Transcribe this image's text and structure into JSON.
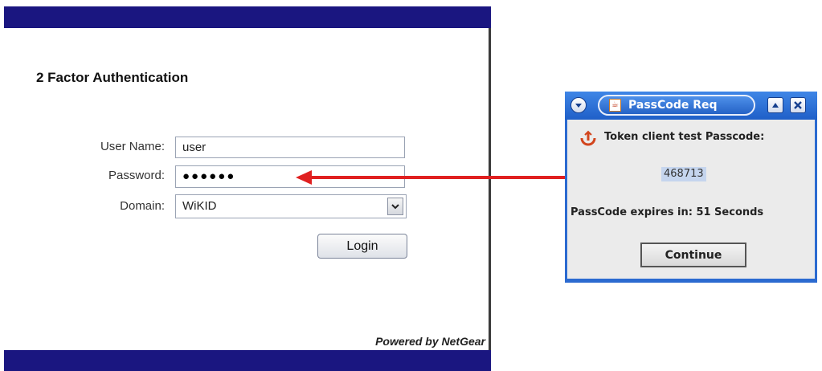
{
  "login": {
    "title": "2 Factor Authentication",
    "username_label": "User Name:",
    "username_value": "user",
    "password_label": "Password:",
    "password_masked": "●●●●●●",
    "domain_label": "Domain:",
    "domain_value": "WiKID",
    "login_button": "Login",
    "powered_by": "Powered by NetGear",
    "bar_color": "#1a1680"
  },
  "passcode_window": {
    "title": "PassCode Req",
    "token_label": "Token client test Passcode:",
    "passcode": "468713",
    "expires": "PassCode expires in: 51 Seconds",
    "continue_button": "Continue",
    "frame_color": "#2b6ad0"
  },
  "arrow": {
    "color": "#e02020",
    "points_to": "password-field"
  },
  "icons": {
    "window_menu": "window-menu-icon",
    "java_app": "java-app-icon",
    "maximize": "maximize-icon",
    "close": "close-icon",
    "token": "wikid-token-icon",
    "dropdown": "chevron-down-icon"
  }
}
